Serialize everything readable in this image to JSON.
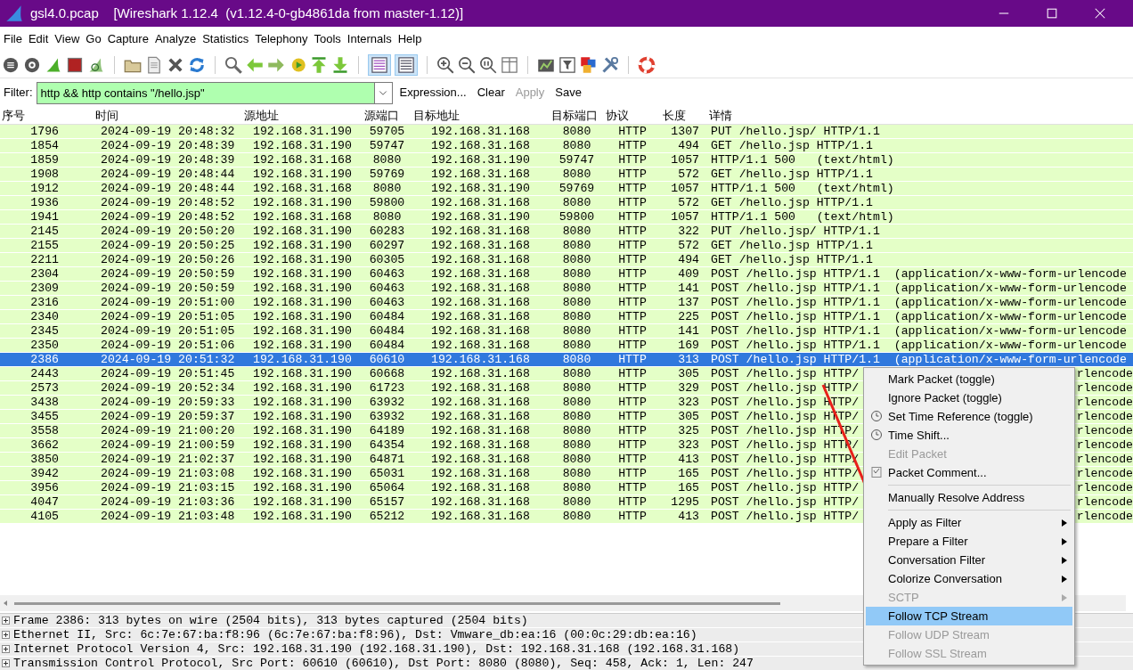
{
  "window": {
    "title": "gsl4.0.pcap    [Wireshark 1.12.4  (v1.12.4-0-gb4861da from master-1.12)]"
  },
  "menu_bar": [
    "File",
    "Edit",
    "View",
    "Go",
    "Capture",
    "Analyze",
    "Statistics",
    "Telephony",
    "Tools",
    "Internals",
    "Help"
  ],
  "toolbar_toggles": [
    {
      "selected": true
    },
    {
      "selected": true
    }
  ],
  "filter_bar": {
    "label": "Filter:",
    "value": "http && http contains \"/hello.jsp\"",
    "actions": [
      {
        "label": "Expression...",
        "disabled": false
      },
      {
        "label": "Clear",
        "disabled": false
      },
      {
        "label": "Apply",
        "disabled": true
      },
      {
        "label": "Save",
        "disabled": false
      }
    ]
  },
  "table": {
    "columns": [
      "序号",
      "时间",
      "源地址",
      "源端口",
      "目标地址",
      "目标端口",
      "协议",
      "长度",
      "详情"
    ],
    "rows": [
      {
        "no": "1796",
        "time": "2024-09-19 20:48:32",
        "src": "192.168.31.190",
        "sport": "59705",
        "dst": "192.168.31.168",
        "dport": "8080",
        "proto": "HTTP",
        "len": "1307",
        "info": "PUT /hello.jsp/ HTTP/1.1",
        "selected": false
      },
      {
        "no": "1854",
        "time": "2024-09-19 20:48:39",
        "src": "192.168.31.190",
        "sport": "59747",
        "dst": "192.168.31.168",
        "dport": "8080",
        "proto": "HTTP",
        "len": "494",
        "info": "GET /hello.jsp HTTP/1.1",
        "selected": false
      },
      {
        "no": "1859",
        "time": "2024-09-19 20:48:39",
        "src": "192.168.31.168",
        "sport": "8080",
        "dst": "192.168.31.190",
        "dport": "59747",
        "proto": "HTTP",
        "len": "1057",
        "info": "HTTP/1.1 500   (text/html)",
        "selected": false
      },
      {
        "no": "1908",
        "time": "2024-09-19 20:48:44",
        "src": "192.168.31.190",
        "sport": "59769",
        "dst": "192.168.31.168",
        "dport": "8080",
        "proto": "HTTP",
        "len": "572",
        "info": "GET /hello.jsp HTTP/1.1",
        "selected": false
      },
      {
        "no": "1912",
        "time": "2024-09-19 20:48:44",
        "src": "192.168.31.168",
        "sport": "8080",
        "dst": "192.168.31.190",
        "dport": "59769",
        "proto": "HTTP",
        "len": "1057",
        "info": "HTTP/1.1 500   (text/html)",
        "selected": false
      },
      {
        "no": "1936",
        "time": "2024-09-19 20:48:52",
        "src": "192.168.31.190",
        "sport": "59800",
        "dst": "192.168.31.168",
        "dport": "8080",
        "proto": "HTTP",
        "len": "572",
        "info": "GET /hello.jsp HTTP/1.1",
        "selected": false
      },
      {
        "no": "1941",
        "time": "2024-09-19 20:48:52",
        "src": "192.168.31.168",
        "sport": "8080",
        "dst": "192.168.31.190",
        "dport": "59800",
        "proto": "HTTP",
        "len": "1057",
        "info": "HTTP/1.1 500   (text/html)",
        "selected": false
      },
      {
        "no": "2145",
        "time": "2024-09-19 20:50:20",
        "src": "192.168.31.190",
        "sport": "60283",
        "dst": "192.168.31.168",
        "dport": "8080",
        "proto": "HTTP",
        "len": "322",
        "info": "PUT /hello.jsp/ HTTP/1.1",
        "selected": false
      },
      {
        "no": "2155",
        "time": "2024-09-19 20:50:25",
        "src": "192.168.31.190",
        "sport": "60297",
        "dst": "192.168.31.168",
        "dport": "8080",
        "proto": "HTTP",
        "len": "572",
        "info": "GET /hello.jsp HTTP/1.1",
        "selected": false
      },
      {
        "no": "2211",
        "time": "2024-09-19 20:50:26",
        "src": "192.168.31.190",
        "sport": "60305",
        "dst": "192.168.31.168",
        "dport": "8080",
        "proto": "HTTP",
        "len": "494",
        "info": "GET /hello.jsp HTTP/1.1",
        "selected": false
      },
      {
        "no": "2304",
        "time": "2024-09-19 20:50:59",
        "src": "192.168.31.190",
        "sport": "60463",
        "dst": "192.168.31.168",
        "dport": "8080",
        "proto": "HTTP",
        "len": "409",
        "info": "POST /hello.jsp HTTP/1.1  (application/x-www-form-urlencode",
        "selected": false
      },
      {
        "no": "2309",
        "time": "2024-09-19 20:50:59",
        "src": "192.168.31.190",
        "sport": "60463",
        "dst": "192.168.31.168",
        "dport": "8080",
        "proto": "HTTP",
        "len": "141",
        "info": "POST /hello.jsp HTTP/1.1  (application/x-www-form-urlencode",
        "selected": false
      },
      {
        "no": "2316",
        "time": "2024-09-19 20:51:00",
        "src": "192.168.31.190",
        "sport": "60463",
        "dst": "192.168.31.168",
        "dport": "8080",
        "proto": "HTTP",
        "len": "137",
        "info": "POST /hello.jsp HTTP/1.1  (application/x-www-form-urlencode",
        "selected": false
      },
      {
        "no": "2340",
        "time": "2024-09-19 20:51:05",
        "src": "192.168.31.190",
        "sport": "60484",
        "dst": "192.168.31.168",
        "dport": "8080",
        "proto": "HTTP",
        "len": "225",
        "info": "POST /hello.jsp HTTP/1.1  (application/x-www-form-urlencode",
        "selected": false
      },
      {
        "no": "2345",
        "time": "2024-09-19 20:51:05",
        "src": "192.168.31.190",
        "sport": "60484",
        "dst": "192.168.31.168",
        "dport": "8080",
        "proto": "HTTP",
        "len": "141",
        "info": "POST /hello.jsp HTTP/1.1  (application/x-www-form-urlencode",
        "selected": false
      },
      {
        "no": "2350",
        "time": "2024-09-19 20:51:06",
        "src": "192.168.31.190",
        "sport": "60484",
        "dst": "192.168.31.168",
        "dport": "8080",
        "proto": "HTTP",
        "len": "169",
        "info": "POST /hello.jsp HTTP/1.1  (application/x-www-form-urlencode",
        "selected": false
      },
      {
        "no": "2386",
        "time": "2024-09-19 20:51:32",
        "src": "192.168.31.190",
        "sport": "60610",
        "dst": "192.168.31.168",
        "dport": "8080",
        "proto": "HTTP",
        "len": "313",
        "info": "POST /hello.jsp HTTP/1.1  (application/x-www-form-urlencode",
        "selected": true
      },
      {
        "no": "2443",
        "time": "2024-09-19 20:51:45",
        "src": "192.168.31.190",
        "sport": "60668",
        "dst": "192.168.31.168",
        "dport": "8080",
        "proto": "HTTP",
        "len": "305",
        "info": "POST /hello.jsp HTTP/",
        "info_tail": "rlencode",
        "selected": false
      },
      {
        "no": "2573",
        "time": "2024-09-19 20:52:34",
        "src": "192.168.31.190",
        "sport": "61723",
        "dst": "192.168.31.168",
        "dport": "8080",
        "proto": "HTTP",
        "len": "329",
        "info": "POST /hello.jsp HTTP/",
        "info_tail": "rlencode",
        "selected": false
      },
      {
        "no": "3438",
        "time": "2024-09-19 20:59:33",
        "src": "192.168.31.190",
        "sport": "63932",
        "dst": "192.168.31.168",
        "dport": "8080",
        "proto": "HTTP",
        "len": "323",
        "info": "POST /hello.jsp HTTP/",
        "info_tail": "rlencode",
        "selected": false
      },
      {
        "no": "3455",
        "time": "2024-09-19 20:59:37",
        "src": "192.168.31.190",
        "sport": "63932",
        "dst": "192.168.31.168",
        "dport": "8080",
        "proto": "HTTP",
        "len": "305",
        "info": "POST /hello.jsp HTTP/",
        "info_tail": "rlencode",
        "selected": false
      },
      {
        "no": "3558",
        "time": "2024-09-19 21:00:20",
        "src": "192.168.31.190",
        "sport": "64189",
        "dst": "192.168.31.168",
        "dport": "8080",
        "proto": "HTTP",
        "len": "325",
        "info": "POST /hello.jsp HTTP/",
        "info_tail": "rlencode",
        "selected": false
      },
      {
        "no": "3662",
        "time": "2024-09-19 21:00:59",
        "src": "192.168.31.190",
        "sport": "64354",
        "dst": "192.168.31.168",
        "dport": "8080",
        "proto": "HTTP",
        "len": "323",
        "info": "POST /hello.jsp HTTP/",
        "info_tail": "rlencode",
        "selected": false
      },
      {
        "no": "3850",
        "time": "2024-09-19 21:02:37",
        "src": "192.168.31.190",
        "sport": "64871",
        "dst": "192.168.31.168",
        "dport": "8080",
        "proto": "HTTP",
        "len": "413",
        "info": "POST /hello.jsp HTTP/",
        "info_tail": "rlencode",
        "selected": false
      },
      {
        "no": "3942",
        "time": "2024-09-19 21:03:08",
        "src": "192.168.31.190",
        "sport": "65031",
        "dst": "192.168.31.168",
        "dport": "8080",
        "proto": "HTTP",
        "len": "165",
        "info": "POST /hello.jsp HTTP/",
        "info_tail": "rlencode",
        "selected": false
      },
      {
        "no": "3956",
        "time": "2024-09-19 21:03:15",
        "src": "192.168.31.190",
        "sport": "65064",
        "dst": "192.168.31.168",
        "dport": "8080",
        "proto": "HTTP",
        "len": "165",
        "info": "POST /hello.jsp HTTP/",
        "info_tail": "rlencode",
        "selected": false
      },
      {
        "no": "4047",
        "time": "2024-09-19 21:03:36",
        "src": "192.168.31.190",
        "sport": "65157",
        "dst": "192.168.31.168",
        "dport": "8080",
        "proto": "HTTP",
        "len": "1295",
        "info": "POST /hello.jsp HTTP/",
        "info_tail": "rlencode",
        "selected": false
      },
      {
        "no": "4105",
        "time": "2024-09-19 21:03:48",
        "src": "192.168.31.190",
        "sport": "65212",
        "dst": "192.168.31.168",
        "dport": "8080",
        "proto": "HTTP",
        "len": "413",
        "info": "POST /hello.jsp HTTP/",
        "info_tail": "rlencode",
        "selected": false
      }
    ]
  },
  "details": [
    {
      "text": "Frame 2386: 313 bytes on wire (2504 bits), 313 bytes captured (2504 bits)",
      "expanded": false
    },
    {
      "text": "Ethernet II, Src: 6c:7e:67:ba:f8:96 (6c:7e:67:ba:f8:96), Dst: Vmware_db:ea:16 (00:0c:29:db:ea:16)",
      "expanded": false
    },
    {
      "text": "Internet Protocol Version 4, Src: 192.168.31.190 (192.168.31.190), Dst: 192.168.31.168 (192.168.31.168)",
      "expanded": false
    },
    {
      "text": "Transmission Control Protocol, Src Port: 60610 (60610), Dst Port: 8080 (8080), Seq: 458, Ack: 1, Len: 247",
      "expanded": false
    }
  ],
  "context_menu": [
    {
      "kind": "plain",
      "label": "Mark Packet (toggle)",
      "disabled": false,
      "selected": false
    },
    {
      "kind": "plain",
      "label": "Ignore Packet (toggle)",
      "disabled": false,
      "selected": false
    },
    {
      "kind": "clock",
      "label": "Set Time Reference (toggle)",
      "disabled": false,
      "selected": false
    },
    {
      "kind": "clock",
      "label": "Time Shift...",
      "disabled": false,
      "selected": false
    },
    {
      "kind": "plain",
      "label": "Edit Packet",
      "disabled": true,
      "selected": false
    },
    {
      "kind": "note",
      "label": "Packet Comment...",
      "disabled": false,
      "selected": false
    },
    {
      "kind": "separator"
    },
    {
      "kind": "plain",
      "label": "Manually Resolve Address",
      "disabled": false,
      "selected": false
    },
    {
      "kind": "separator"
    },
    {
      "kind": "submenu",
      "label": "Apply as Filter",
      "disabled": false,
      "selected": false
    },
    {
      "kind": "submenu",
      "label": "Prepare a Filter",
      "disabled": false,
      "selected": false
    },
    {
      "kind": "submenu",
      "label": "Conversation Filter",
      "disabled": false,
      "selected": false
    },
    {
      "kind": "submenu",
      "label": "Colorize Conversation",
      "disabled": false,
      "selected": false
    },
    {
      "kind": "submenu",
      "label": "SCTP",
      "disabled": true,
      "selected": false
    },
    {
      "kind": "plain",
      "label": "Follow TCP Stream",
      "disabled": false,
      "selected": true
    },
    {
      "kind": "plain",
      "label": "Follow UDP Stream",
      "disabled": true,
      "selected": false
    },
    {
      "kind": "plain",
      "label": "Follow SSL Stream",
      "disabled": true,
      "selected": false
    }
  ]
}
